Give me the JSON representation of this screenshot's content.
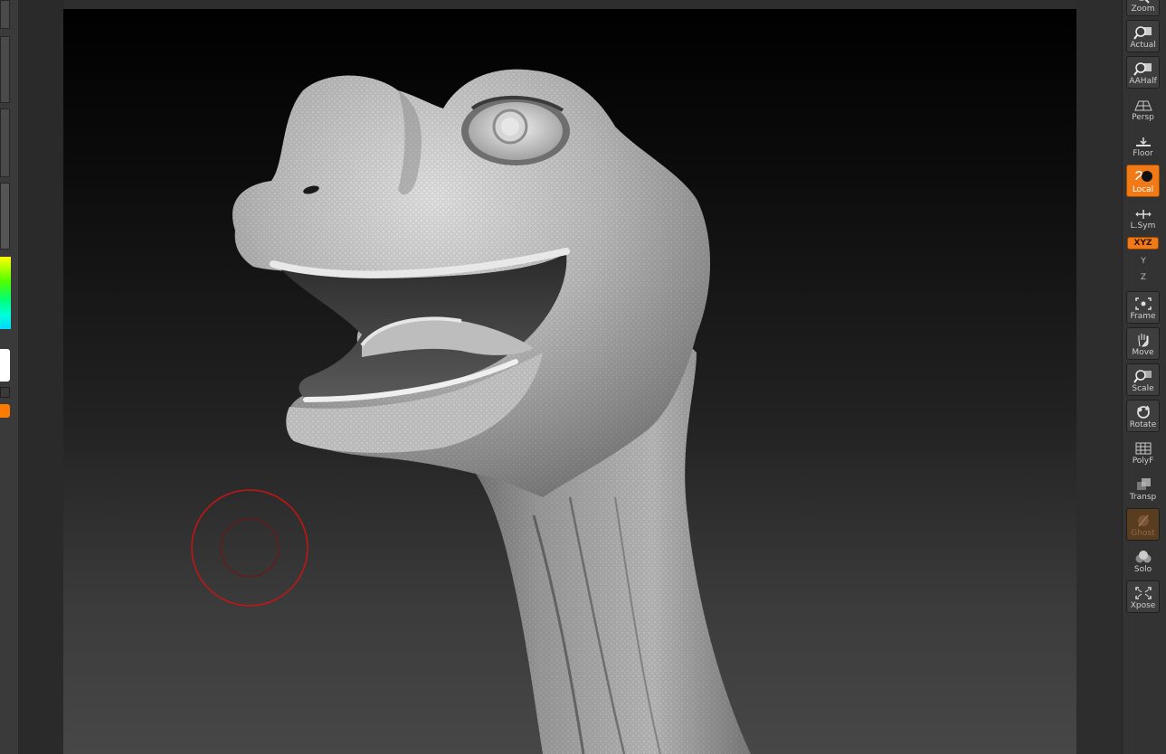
{
  "right_shelf": {
    "buttons": [
      {
        "id": "zoom",
        "label": "Zoom",
        "icon": "zoom-icon"
      },
      {
        "id": "actual",
        "label": "Actual",
        "icon": "magnify-icon"
      },
      {
        "id": "aahalf",
        "label": "AAHalf",
        "icon": "magnify-aa-icon"
      },
      {
        "id": "persp",
        "label": "Persp",
        "icon": "perspective-grid-icon"
      },
      {
        "id": "floor",
        "label": "Floor",
        "icon": "floor-icon"
      },
      {
        "id": "local",
        "label": "Local",
        "icon": "local-pivot-icon",
        "active": true
      },
      {
        "id": "lsym",
        "label": "L.Sym",
        "icon": "local-symmetry-icon"
      },
      {
        "id": "frame",
        "label": "Frame",
        "icon": "frame-icon"
      },
      {
        "id": "move",
        "label": "Move",
        "icon": "hand-icon"
      },
      {
        "id": "scale",
        "label": "Scale",
        "icon": "scale-icon"
      },
      {
        "id": "rotate",
        "label": "Rotate",
        "icon": "rotate-icon"
      },
      {
        "id": "polyf",
        "label": "PolyF",
        "icon": "polyframe-grid-icon"
      },
      {
        "id": "transp",
        "label": "Transp",
        "icon": "transparency-icon"
      },
      {
        "id": "ghost",
        "label": "Ghost",
        "icon": "ghost-icon",
        "disabled": true
      },
      {
        "id": "solo",
        "label": "Solo",
        "icon": "solo-spheres-icon"
      },
      {
        "id": "xpose",
        "label": "Xpose",
        "icon": "xpose-arrows-icon"
      }
    ],
    "xyz_label": "XYZ",
    "y_axis_label": "Y",
    "z_axis_label": "Z"
  },
  "colors": {
    "accent": "#f07a18",
    "brush_cursor": "#c81414",
    "panel": "#333333"
  }
}
